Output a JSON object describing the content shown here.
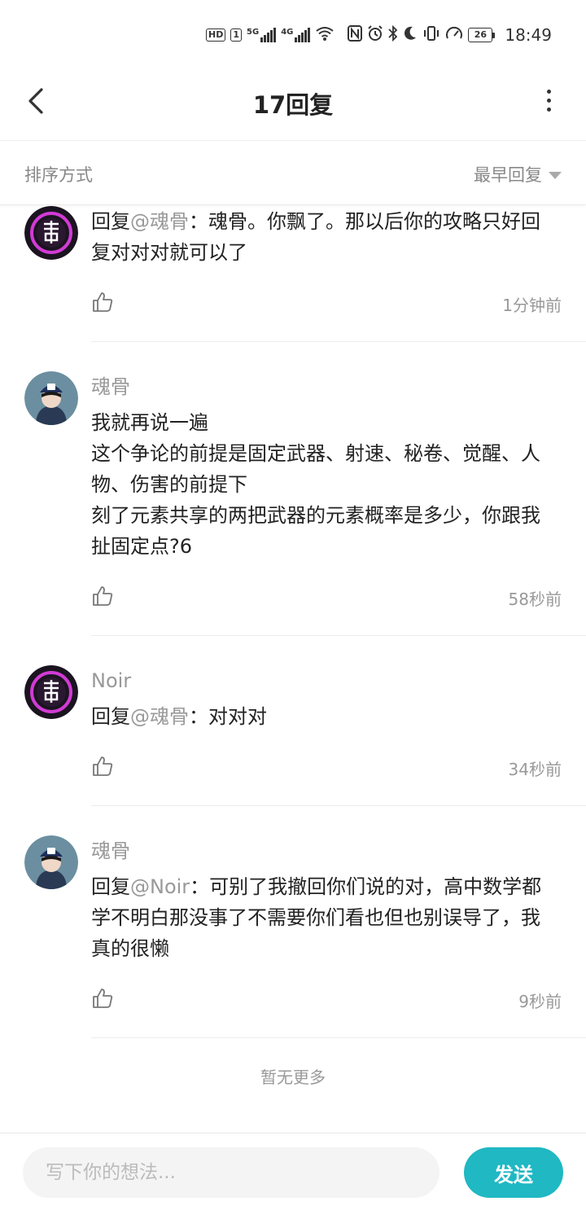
{
  "status_bar": {
    "hd_badge": "HD",
    "sim": "1",
    "signal1_label": "5G",
    "signal2_label": "4G",
    "battery": "26",
    "time": "18:49",
    "icons": [
      "hd-icon",
      "signal-icon",
      "signal-icon",
      "wifi-icon",
      "nfc-icon",
      "alarm-icon",
      "bluetooth-icon",
      "moon-icon",
      "vibrate-icon",
      "speed-icon",
      "battery-icon"
    ]
  },
  "nav": {
    "title": "17回复",
    "back_icon": "chevron-left-icon",
    "more_icon": "more-vertical-icon"
  },
  "sort": {
    "label": "排序方式",
    "selected": "最早回复"
  },
  "comments": [
    {
      "username": "",
      "avatar": "avatar-noir",
      "prefix": "回复",
      "mention": "@魂骨",
      "body": "：魂骨。你飘了。那以后你的攻略只好回复对对对就可以了",
      "time": "1分钟前"
    },
    {
      "username": "魂骨",
      "avatar": "avatar-hungu",
      "prefix": "",
      "mention": "",
      "body": "我就再说一遍\n这个争论的前提是固定武器、射速、秘卷、觉醒、人物、伤害的前提下\n刻了元素共享的两把武器的元素概率是多少，你跟我扯固定点?6",
      "time": "58秒前"
    },
    {
      "username": "Noir",
      "avatar": "avatar-noir",
      "prefix": "回复",
      "mention": "@魂骨",
      "body": "：对对对",
      "time": "34秒前"
    },
    {
      "username": "魂骨",
      "avatar": "avatar-hungu",
      "prefix": "回复",
      "mention": "@Noir",
      "body": "：可别了我撤回你们说的对，高中数学都学不明白那没事了不需要你们看也但也别误导了，我真的很懒",
      "time": "9秒前"
    }
  ],
  "end_text": "暂无更多",
  "input": {
    "placeholder": "写下你的想法...",
    "value": "",
    "send_label": "发送"
  },
  "colors": {
    "accent": "#1fb8c3",
    "muted_text": "#999999",
    "primary_text": "#222222"
  }
}
